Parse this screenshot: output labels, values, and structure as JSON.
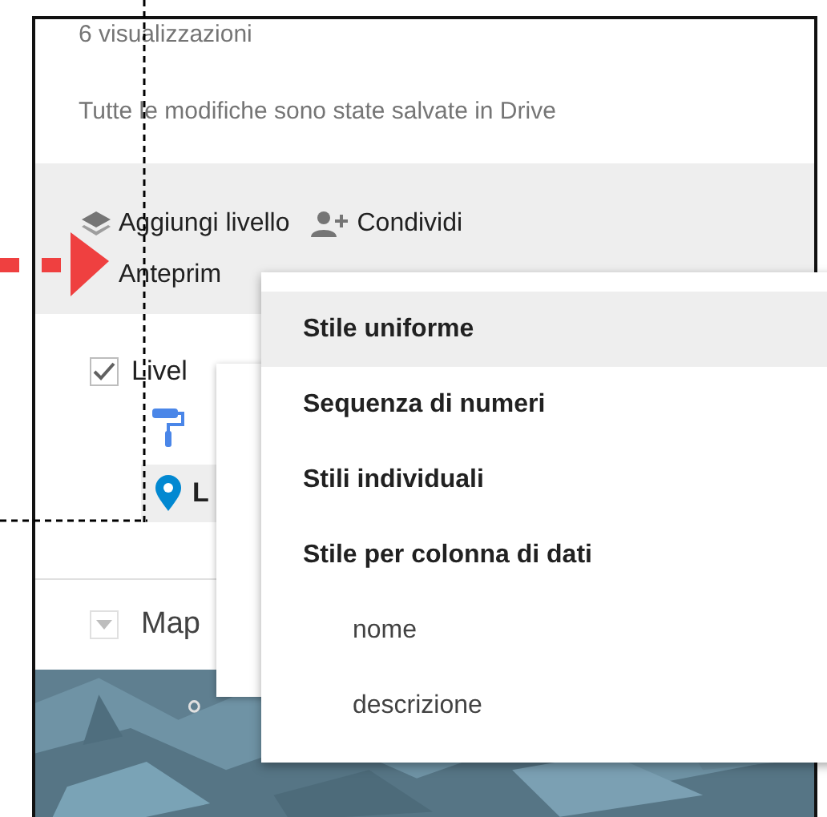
{
  "panel": {
    "views": "6 visualizzazioni",
    "save_status": "Tutte le modifiche sono state salvate in Drive",
    "toolbar": [
      {
        "kind": "add-layer",
        "label": "Aggiungi livello"
      },
      {
        "kind": "share",
        "label": "Condividi"
      },
      {
        "kind": "preview",
        "label": "Anteprim"
      }
    ],
    "layer": {
      "title": "Livel",
      "checked": true,
      "item_label": "L"
    },
    "base_map": {
      "label": "Map"
    }
  },
  "style_menu": {
    "items": [
      {
        "kind": "option",
        "label": "Stile uniforme",
        "selected": true
      },
      {
        "kind": "option",
        "label": "Sequenza di numeri",
        "selected": false
      },
      {
        "kind": "option",
        "label": "Stili individuali",
        "selected": false
      },
      {
        "kind": "option",
        "label": "Stile per colonna di dati",
        "selected": false
      },
      {
        "kind": "column",
        "label": "nome",
        "selected": false
      },
      {
        "kind": "column",
        "label": "descrizione",
        "selected": false
      }
    ]
  }
}
